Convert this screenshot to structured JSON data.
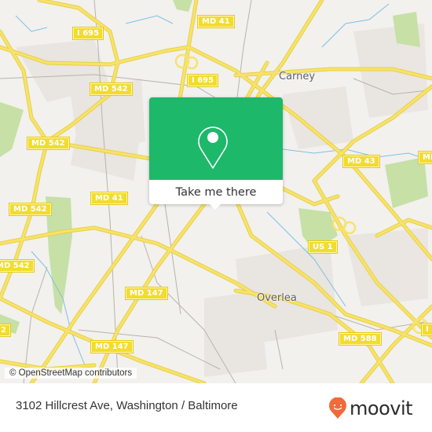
{
  "map": {
    "attribution": "© OpenStreetMap contributors",
    "colors": {
      "background": "#f2f1ee",
      "major_road": "#f7e36a",
      "minor_road": "#b8b3ad",
      "water": "#7fbfe6",
      "park": "#c6e0a6",
      "urban": "#e8e3df"
    },
    "place_labels": [
      {
        "name": "Carney"
      },
      {
        "name": "Overlea"
      }
    ],
    "road_shields": [
      {
        "label": "MD 41"
      },
      {
        "label": "I 695"
      },
      {
        "label": "I 695"
      },
      {
        "label": "MD 542"
      },
      {
        "label": "MD 542"
      },
      {
        "label": "MD 542"
      },
      {
        "label": "MD 542"
      },
      {
        "label": "542"
      },
      {
        "label": "2"
      },
      {
        "label": "MD 41"
      },
      {
        "label": "MD 43"
      },
      {
        "label": "MD"
      },
      {
        "label": "US 1"
      },
      {
        "label": "MD 147"
      },
      {
        "label": "MD 147"
      },
      {
        "label": "MD 588"
      },
      {
        "label": "I"
      }
    ]
  },
  "popup": {
    "accent_color": "#1eb86a",
    "icon": "location-pin-icon",
    "button_label": "Take me there"
  },
  "footer": {
    "address": "3102 Hillcrest Ave, Washington / Baltimore",
    "brand_name": "moovit",
    "brand_icon": "moovit-smiley-pin-icon",
    "brand_color": "#f26a3a"
  }
}
